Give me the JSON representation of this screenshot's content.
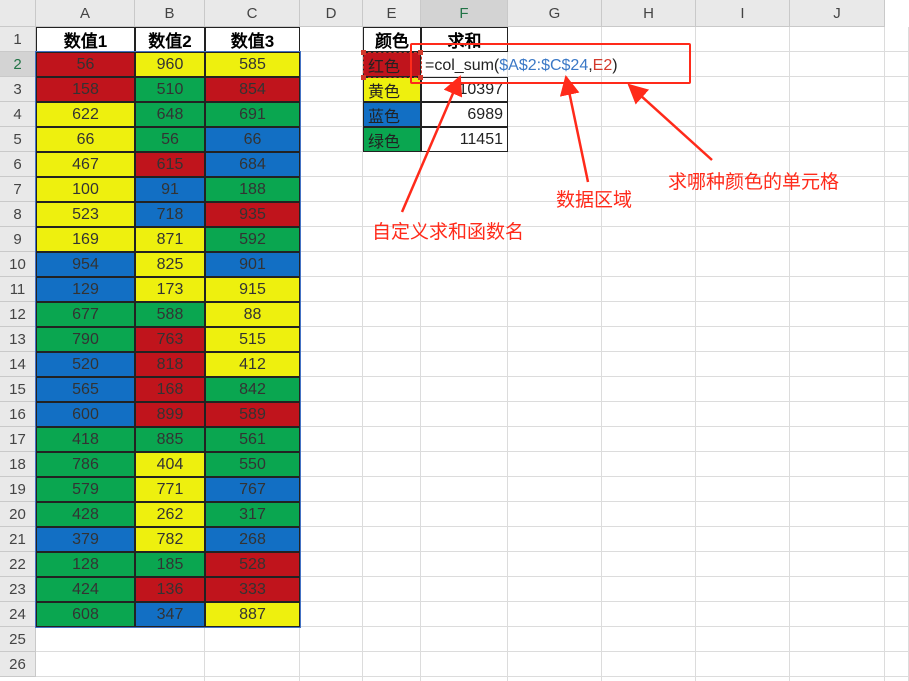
{
  "columns": [
    "A",
    "B",
    "C",
    "D",
    "E",
    "F",
    "G",
    "H",
    "I",
    "J"
  ],
  "rows": [
    "1",
    "2",
    "3",
    "4",
    "5",
    "6",
    "7",
    "8",
    "9",
    "10",
    "11",
    "12",
    "13",
    "14",
    "15",
    "16",
    "17",
    "18",
    "19",
    "20",
    "21",
    "22",
    "23",
    "24",
    "25",
    "26"
  ],
  "data_table": {
    "headers": [
      "数值1",
      "数值2",
      "数值3"
    ],
    "rows": [
      [
        {
          "v": "56",
          "c": "red"
        },
        {
          "v": "960",
          "c": "yellow"
        },
        {
          "v": "585",
          "c": "yellow"
        }
      ],
      [
        {
          "v": "158",
          "c": "red"
        },
        {
          "v": "510",
          "c": "green"
        },
        {
          "v": "854",
          "c": "red"
        }
      ],
      [
        {
          "v": "622",
          "c": "yellow"
        },
        {
          "v": "648",
          "c": "green"
        },
        {
          "v": "691",
          "c": "green"
        }
      ],
      [
        {
          "v": "66",
          "c": "yellow"
        },
        {
          "v": "56",
          "c": "green"
        },
        {
          "v": "66",
          "c": "blue"
        }
      ],
      [
        {
          "v": "467",
          "c": "yellow"
        },
        {
          "v": "615",
          "c": "red"
        },
        {
          "v": "684",
          "c": "blue"
        }
      ],
      [
        {
          "v": "100",
          "c": "yellow"
        },
        {
          "v": "91",
          "c": "blue"
        },
        {
          "v": "188",
          "c": "green"
        }
      ],
      [
        {
          "v": "523",
          "c": "yellow"
        },
        {
          "v": "718",
          "c": "blue"
        },
        {
          "v": "935",
          "c": "red"
        }
      ],
      [
        {
          "v": "169",
          "c": "yellow"
        },
        {
          "v": "871",
          "c": "yellow"
        },
        {
          "v": "592",
          "c": "green"
        }
      ],
      [
        {
          "v": "954",
          "c": "blue"
        },
        {
          "v": "825",
          "c": "yellow"
        },
        {
          "v": "901",
          "c": "blue"
        }
      ],
      [
        {
          "v": "129",
          "c": "blue"
        },
        {
          "v": "173",
          "c": "yellow"
        },
        {
          "v": "915",
          "c": "yellow"
        }
      ],
      [
        {
          "v": "677",
          "c": "green"
        },
        {
          "v": "588",
          "c": "green"
        },
        {
          "v": "88",
          "c": "yellow"
        }
      ],
      [
        {
          "v": "790",
          "c": "green"
        },
        {
          "v": "763",
          "c": "red"
        },
        {
          "v": "515",
          "c": "yellow"
        }
      ],
      [
        {
          "v": "520",
          "c": "blue"
        },
        {
          "v": "818",
          "c": "red"
        },
        {
          "v": "412",
          "c": "yellow"
        }
      ],
      [
        {
          "v": "565",
          "c": "blue"
        },
        {
          "v": "168",
          "c": "red"
        },
        {
          "v": "842",
          "c": "green"
        }
      ],
      [
        {
          "v": "600",
          "c": "blue"
        },
        {
          "v": "899",
          "c": "red"
        },
        {
          "v": "589",
          "c": "red"
        }
      ],
      [
        {
          "v": "418",
          "c": "green"
        },
        {
          "v": "885",
          "c": "green"
        },
        {
          "v": "561",
          "c": "green"
        }
      ],
      [
        {
          "v": "786",
          "c": "green"
        },
        {
          "v": "404",
          "c": "yellow"
        },
        {
          "v": "550",
          "c": "green"
        }
      ],
      [
        {
          "v": "579",
          "c": "green"
        },
        {
          "v": "771",
          "c": "yellow"
        },
        {
          "v": "767",
          "c": "blue"
        }
      ],
      [
        {
          "v": "428",
          "c": "green"
        },
        {
          "v": "262",
          "c": "yellow"
        },
        {
          "v": "317",
          "c": "green"
        }
      ],
      [
        {
          "v": "379",
          "c": "blue"
        },
        {
          "v": "782",
          "c": "yellow"
        },
        {
          "v": "268",
          "c": "blue"
        }
      ],
      [
        {
          "v": "128",
          "c": "green"
        },
        {
          "v": "185",
          "c": "green"
        },
        {
          "v": "528",
          "c": "red"
        }
      ],
      [
        {
          "v": "424",
          "c": "green"
        },
        {
          "v": "136",
          "c": "red"
        },
        {
          "v": "333",
          "c": "red"
        }
      ],
      [
        {
          "v": "608",
          "c": "green"
        },
        {
          "v": "347",
          "c": "blue"
        },
        {
          "v": "887",
          "c": "yellow"
        }
      ]
    ]
  },
  "summary_table": {
    "header_color": "颜色",
    "header_sum": "求和",
    "rows": [
      {
        "label": "红色",
        "color": "red",
        "sum": ""
      },
      {
        "label": "黄色",
        "color": "yellow",
        "sum": "10397"
      },
      {
        "label": "蓝色",
        "color": "blue",
        "sum": "6989"
      },
      {
        "label": "绿色",
        "color": "green",
        "sum": "11451"
      }
    ]
  },
  "formula": {
    "prefix": "=col_sum(",
    "range": "$A$2:$C$24",
    "comma": ",",
    "ref": "E2",
    "suffix": ")"
  },
  "annotations": {
    "func_name": "自定义求和函数名",
    "data_range": "数据区域",
    "color_cell": "求哪种颜色的单元格"
  },
  "colors": {
    "red": "#c0141c",
    "yellow": "#eef00e",
    "green": "#0aa650",
    "blue": "#126fc4",
    "annotation": "#ff2a1a",
    "range_ref": "#3a78c6"
  },
  "active_cell": "F2"
}
